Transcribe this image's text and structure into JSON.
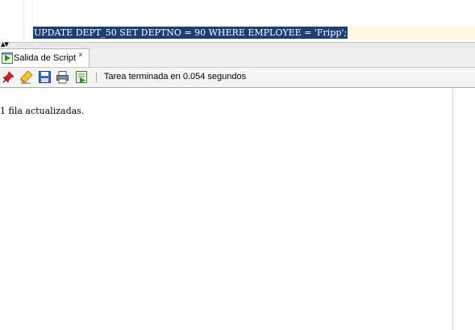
{
  "editor": {
    "sql_line": "UPDATE DEPT_50 SET DEPTNO = 90 WHERE EMPLOYEE = 'Fripp';"
  },
  "tab": {
    "label": "Salida de Script",
    "close": "×",
    "icon": "script-output-icon"
  },
  "toolbar": {
    "icons": [
      "pin-icon",
      "eraser-icon",
      "save-icon",
      "print-icon",
      "run-script-icon"
    ],
    "status": "Tarea terminada en 0.054 segundos"
  },
  "output": {
    "text": "1 fila actualizadas."
  },
  "colors": {
    "selection": "#1d3f76",
    "current_line": "#fdf9e2"
  }
}
